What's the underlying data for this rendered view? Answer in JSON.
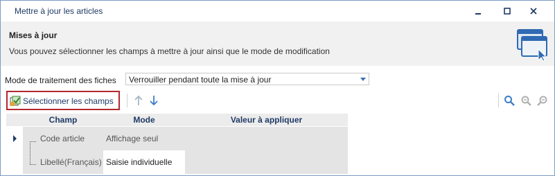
{
  "window": {
    "title": "Mettre à jour les articles"
  },
  "header": {
    "title": "Mises à jour",
    "description": "Vous pouvez sélectionner les champs à mettre à jour ainsi que le mode de modification",
    "icon": "window-cursor-icon"
  },
  "mode": {
    "label": "Mode de traitement des fiches",
    "value": "Verrouiller pendant toute la mise à jour"
  },
  "toolbar": {
    "select_fields_label": "Sélectionner les champs",
    "icons": [
      "arrow-up-icon",
      "arrow-down-icon",
      "search-icon",
      "search-previous-icon",
      "search-next-icon"
    ]
  },
  "grid": {
    "columns": [
      "Champ",
      "Mode",
      "Valeur à appliquer"
    ],
    "rows": [
      {
        "champ": "Code article",
        "mode": "Affichage seul",
        "valeur": ""
      },
      {
        "champ": "Libellé(Français)",
        "mode": "Saisie individuelle",
        "valeur": ""
      }
    ]
  },
  "colors": {
    "accent": "#1f3a66",
    "highlight_border": "#b3272d",
    "icon_blue": "#3a7dc9"
  }
}
